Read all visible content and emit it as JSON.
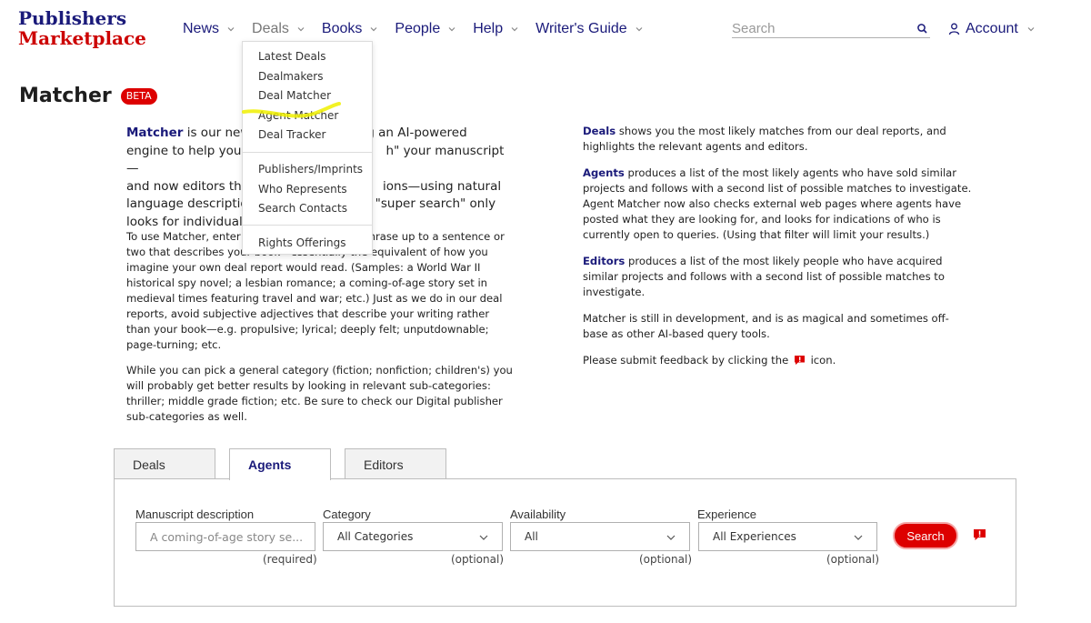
{
  "logo": {
    "line1": "Publishers",
    "line2": "Marketplace"
  },
  "nav": {
    "items": [
      {
        "label": "News"
      },
      {
        "label": "Deals"
      },
      {
        "label": "Books"
      },
      {
        "label": "People"
      },
      {
        "label": "Help"
      },
      {
        "label": "Writer's Guide"
      }
    ],
    "active": "Deals"
  },
  "search": {
    "placeholder": "Search",
    "icon": "search-icon"
  },
  "account": {
    "label": "Account",
    "icon": "user-icon"
  },
  "deals_menu": {
    "items": [
      {
        "label": "Latest Deals"
      },
      {
        "label": "Dealmakers"
      },
      {
        "label": "Deal Matcher"
      },
      {
        "label": "Agent Matcher"
      },
      {
        "label": "Deal Tracker"
      },
      {
        "label": "Publishers/Imprints"
      },
      {
        "label": "Who Represents"
      },
      {
        "label": "Search Contacts"
      },
      {
        "label": "Rights Offerings"
      }
    ],
    "highlighted": "Agent Matcher",
    "highlight_color": "#f0f000"
  },
  "page": {
    "title": "Matcher",
    "badge": "BETA"
  },
  "intro": {
    "keyword": "Matcher",
    "lines": [
      " is our new",
      "using an AI-powered",
      "engine to help you f",
      "h\" your manuscript—",
      "and now editors tha",
      "ions—using natural",
      "language descriptio",
      "\"super search\" only",
      "looks for individual k"
    ]
  },
  "howto": {
    "p1": [
      "To use Matcher, enter",
      "hrase up to a sentence or",
      "two that describes your book—essentially the equivalent of how you",
      "imagine your own deal report would read. (Samples: a World War II",
      "historical spy novel; a lesbian romance; a coming-of-age story set in",
      "medieval times featuring travel and war; etc.) Just as we do in our deal",
      "reports, avoid subjective adjectives that describe your writing rather",
      "than your book—e.g. propulsive; lyrical; deeply felt; unputdownable;",
      "page-turning; etc."
    ],
    "p2": "While you can pick a general category (fiction; nonfiction; children's) you will probably get better results by looking in relevant sub-categories: thriller; middle grade fiction; etc. Be sure to check our Digital publisher sub-categories as well."
  },
  "right": {
    "deals_kw": "Deals",
    "deals_text": " shows you the most likely matches from our deal reports, and highlights the relevant agents and editors.",
    "agents_kw": "Agents",
    "agents_text": " produces a list of the most likely agents who have sold similar projects and follows with a second list of possible matches to investigate. Agent Matcher now also checks external web pages where agents have posted what they are looking for, and looks for indications of who is currently open to queries. (Using that filter will limit your results.)",
    "editors_kw": "Editors",
    "editors_text": " produces a list of the most likely people who have acquired similar projects and follows with a second list of possible matches to investigate.",
    "dev_text": "Matcher is still in development, and is as magical and sometimes off-base as other AI-based query tools.",
    "feedback_before": "Please submit feedback by clicking the ",
    "feedback_after": " icon."
  },
  "tabs": [
    {
      "label": "Deals"
    },
    {
      "label": "Agents"
    },
    {
      "label": "Editors"
    }
  ],
  "active_tab": "Agents",
  "form": {
    "manuscript": {
      "label": "Manuscript description",
      "placeholder": "A coming-of-age story se...",
      "note": "(required)"
    },
    "category": {
      "label": "Category",
      "value": "All Categories",
      "note": "(optional)"
    },
    "availability": {
      "label": "Availability",
      "value": "All",
      "note": "(optional)"
    },
    "experience": {
      "label": "Experience",
      "value": "All Experiences",
      "note": "(optional)"
    },
    "search_label": "Search",
    "feedback_icon": "feedback-icon"
  },
  "colors": {
    "brand_navy": "#1a1a7a",
    "brand_red": "#dd0000"
  }
}
